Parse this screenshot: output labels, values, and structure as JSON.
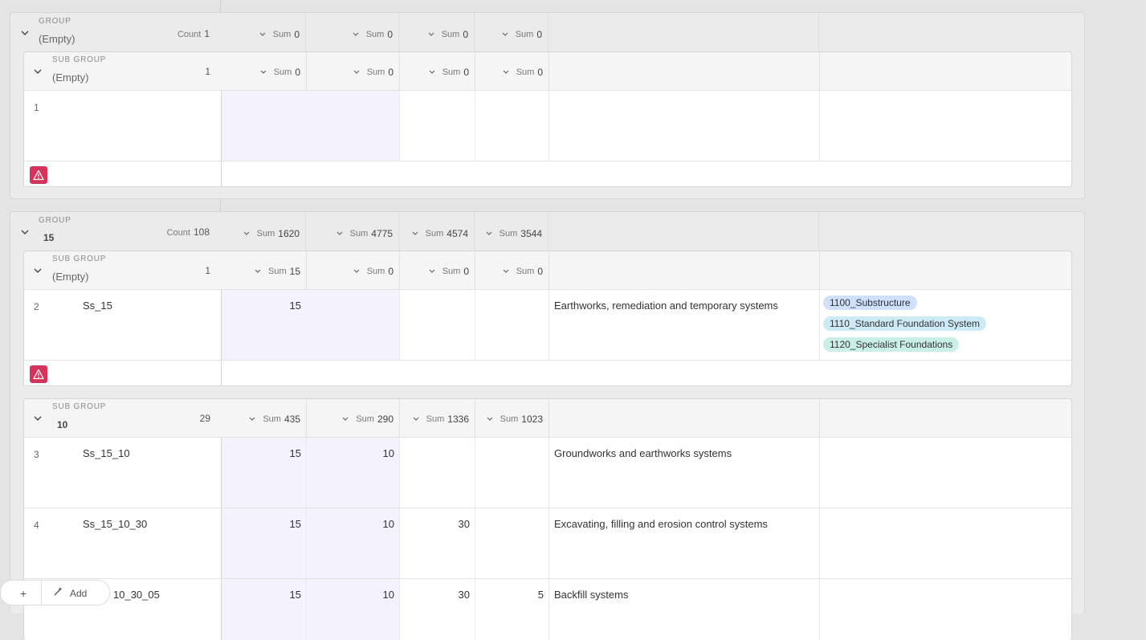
{
  "labels": {
    "group": "GROUP",
    "sub_group": "SUB GROUP",
    "count": "Count",
    "sum": "Sum"
  },
  "group1": {
    "name": "(Empty)",
    "count": "1",
    "sums": [
      "0",
      "0",
      "0",
      "0"
    ],
    "sub1": {
      "name": "(Empty)",
      "count": "1",
      "sums": [
        "0",
        "0",
        "0",
        "0"
      ],
      "rows": [
        {
          "num": "1",
          "code": "",
          "v1": "",
          "v2": "",
          "v3": "",
          "v4": "",
          "desc": ""
        }
      ]
    }
  },
  "group2": {
    "name": "15",
    "count": "108",
    "sums": [
      "1620",
      "4775",
      "4574",
      "3544"
    ],
    "sub1": {
      "name": "(Empty)",
      "count": "1",
      "sums": [
        "15",
        "0",
        "0",
        "0"
      ],
      "rows": [
        {
          "num": "2",
          "code": "Ss_15",
          "v1": "15",
          "v2": "",
          "v3": "",
          "v4": "",
          "desc": "Earthworks, remediation and temporary systems",
          "tags": [
            "1100_Substructure",
            "1110_Standard Foundation System",
            "1120_Specialist Foundations"
          ]
        }
      ]
    },
    "sub2": {
      "name": "10",
      "count": "29",
      "sums": [
        "435",
        "290",
        "1336",
        "1023"
      ],
      "rows": [
        {
          "num": "3",
          "code": "Ss_15_10",
          "v1": "15",
          "v2": "10",
          "v3": "",
          "v4": "",
          "desc": "Groundworks and earthworks systems"
        },
        {
          "num": "4",
          "code": "Ss_15_10_30",
          "v1": "15",
          "v2": "10",
          "v3": "30",
          "v4": "",
          "desc": "Excavating, filling and erosion control systems"
        },
        {
          "num": "",
          "code": "10_30_05",
          "v1": "15",
          "v2": "10",
          "v3": "30",
          "v4": "5",
          "desc": "Backfill systems"
        }
      ]
    }
  },
  "tag_colors": [
    "#cfe0fb",
    "#cdeaf7",
    "#c9efe7"
  ],
  "footer": {
    "add_label": "Add"
  }
}
